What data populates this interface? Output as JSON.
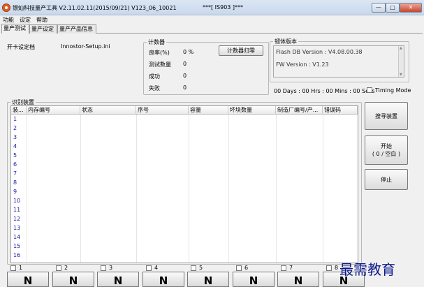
{
  "window": {
    "title": "银灿科技量产工具 V2.11.02.11(2015/09/21)    V123_06_10021",
    "title_right": "***[ IS903 ]***",
    "min_label": "—",
    "max_label": "□",
    "close_label": "✕"
  },
  "menu": [
    "功能",
    "设定",
    "帮助"
  ],
  "tabs": [
    "量产测试",
    "量产设定",
    "量产产品信息"
  ],
  "settings_file": {
    "label": "开卡设定档",
    "value": "Innostor-Setup.ini"
  },
  "counter": {
    "title": "计数器",
    "rows": [
      {
        "label": "良率(%)",
        "value": "0 %"
      },
      {
        "label": "测试数量",
        "value": "0"
      },
      {
        "label": "成功",
        "value": "0"
      },
      {
        "label": "失败",
        "value": "0"
      }
    ],
    "reset_button": "计数器归零"
  },
  "firmware": {
    "title": "韧体版本",
    "flash_db": "Flash DB Version :  V4.08.00.38",
    "fw": "FW Version :   V1.23"
  },
  "timer": {
    "text": "00 Days : 00 Hrs : 00 Mins : 00 Secs",
    "timing_mode": "Timing Mode"
  },
  "devices": {
    "title": "识别装置",
    "columns": [
      "装...",
      "内存编号",
      "状态",
      "序号",
      "容量",
      "坏块数量",
      "制造厂编号/产...",
      "错误码"
    ],
    "rows": [
      "1",
      "2",
      "3",
      "4",
      "5",
      "6",
      "7",
      "8",
      "9",
      "10",
      "11",
      "12",
      "13",
      "14",
      "15",
      "16"
    ]
  },
  "side_buttons": {
    "search": "搜寻装置",
    "start_line1": "开始",
    "start_line2": "( 0 / 空白 )",
    "stop": "停止"
  },
  "slots": [
    {
      "label": "1",
      "status": "N"
    },
    {
      "label": "2",
      "status": "N"
    },
    {
      "label": "3",
      "status": "N"
    },
    {
      "label": "4",
      "status": "N"
    },
    {
      "label": "5",
      "status": "N"
    },
    {
      "label": "6",
      "status": "N"
    },
    {
      "label": "7",
      "status": "N"
    },
    {
      "label": "8",
      "status": "N"
    }
  ],
  "watermark": "最需教育"
}
